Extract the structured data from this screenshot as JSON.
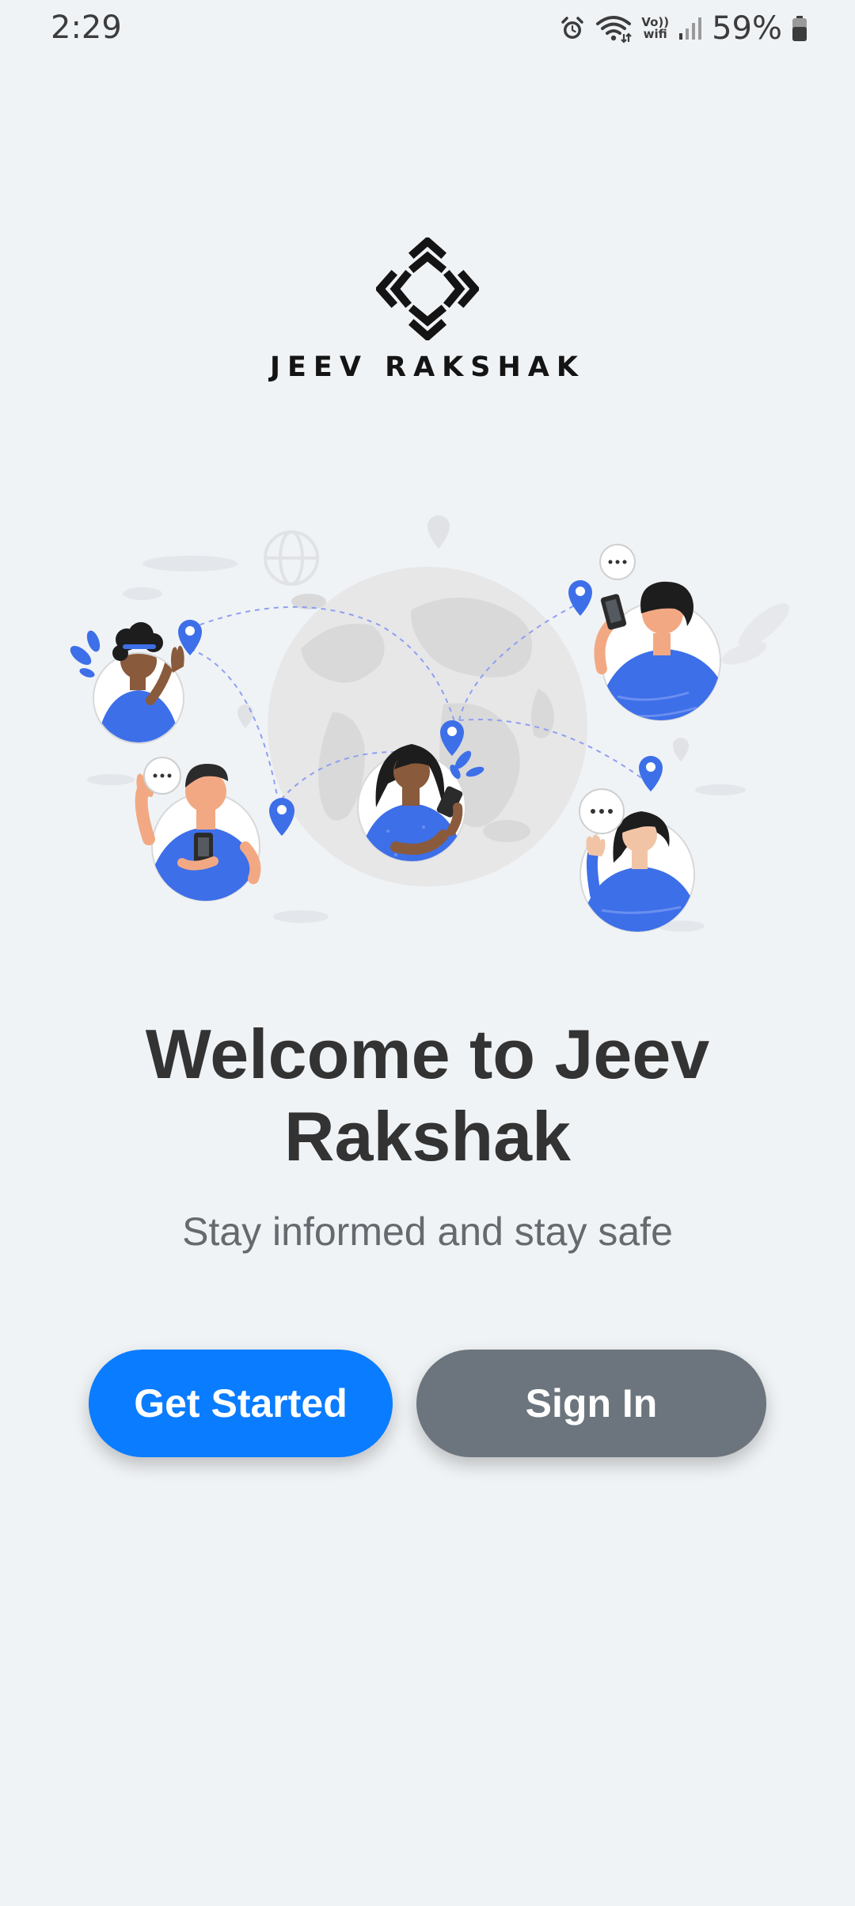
{
  "status_bar": {
    "time": "2:29",
    "volte_top": "Vo))",
    "volte_bottom": "wifi",
    "battery_percent": "59%",
    "icons": [
      "alarm-icon",
      "wifi-icon",
      "volte-wifi-icon",
      "signal-icon",
      "battery-icon"
    ]
  },
  "logo": {
    "text": "JEEV RAKSHAK"
  },
  "hero": {
    "illustration": "people-connected-around-globe"
  },
  "welcome": {
    "title": "Welcome to Jeev Rakshak",
    "subtitle": "Stay informed and stay safe"
  },
  "buttons": {
    "get_started": "Get Started",
    "sign_in": "Sign In"
  },
  "colors": {
    "background": "#f0f3f6",
    "primary": "#0a7cff",
    "secondary": "#6c757d",
    "illustration_blue": "#3d6fe8",
    "text_dark": "#333333",
    "text_muted": "#666a6e"
  }
}
